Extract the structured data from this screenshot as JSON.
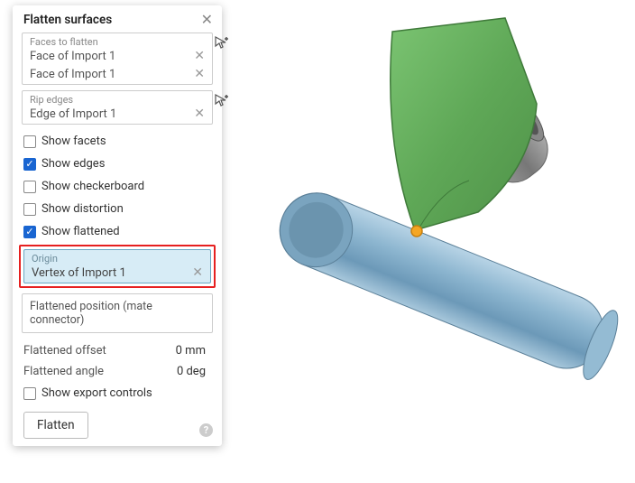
{
  "panel": {
    "title": "Flatten surfaces",
    "faces": {
      "label": "Faces to flatten",
      "items": [
        "Face of Import 1",
        "Face of Import 1"
      ]
    },
    "rip": {
      "label": "Rip edges",
      "items": [
        "Edge of Import 1"
      ]
    },
    "checks": {
      "show_facets": "Show facets",
      "show_edges": "Show edges",
      "show_checkerboard": "Show checkerboard",
      "show_distortion": "Show distortion",
      "show_flattened": "Show flattened"
    },
    "origin": {
      "label": "Origin",
      "value": "Vertex of Import 1"
    },
    "flattened_position": "Flattened position (mate connector)",
    "offset": {
      "label": "Flattened offset",
      "value": "0 mm"
    },
    "angle": {
      "label": "Flattened angle",
      "value": "0 deg"
    },
    "show_export": "Show export controls",
    "flatten_btn": "Flatten"
  },
  "icons": {
    "close": "✕",
    "check": "✓",
    "help": "?"
  }
}
